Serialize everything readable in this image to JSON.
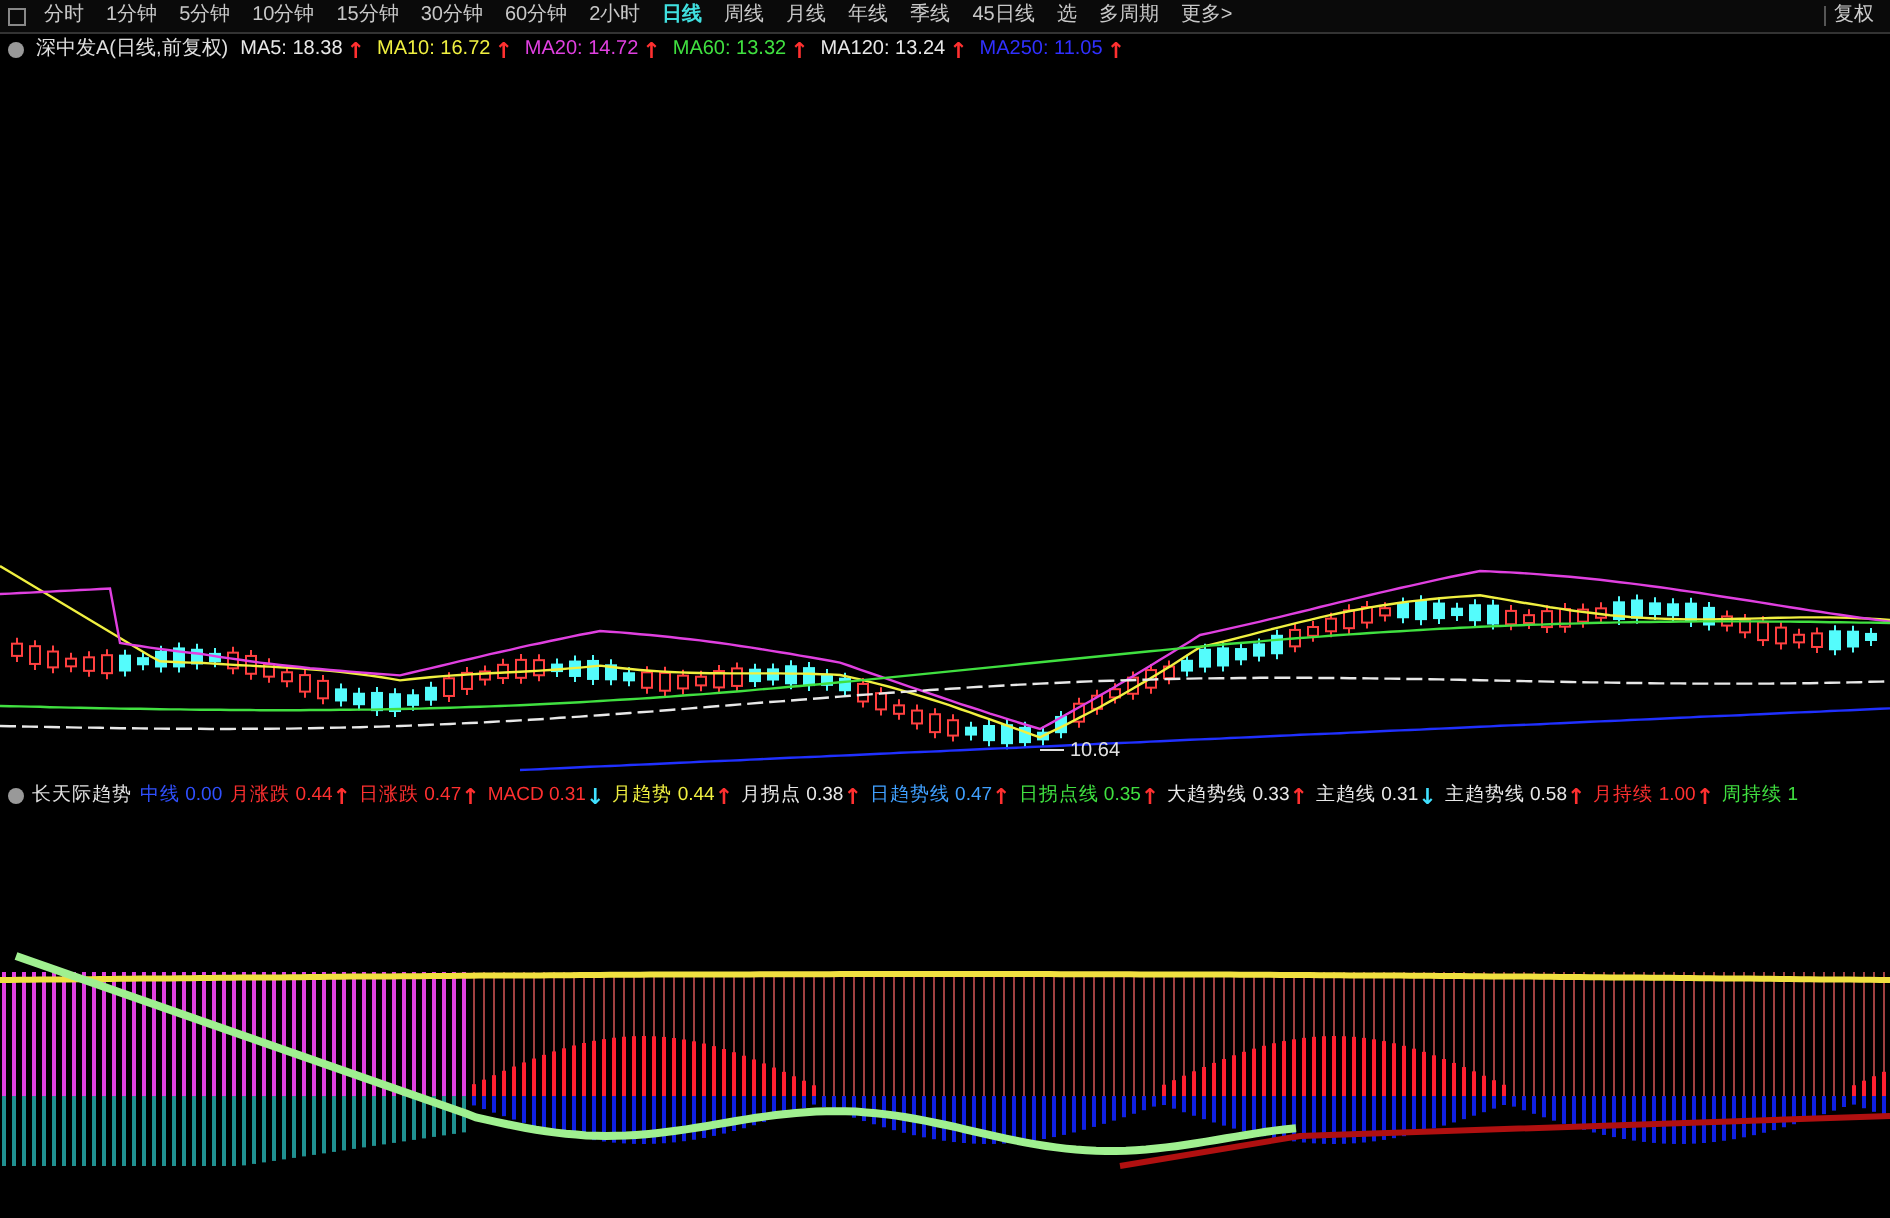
{
  "toolbar": {
    "tabs": [
      {
        "label": "分时",
        "selected": false
      },
      {
        "label": "1分钟",
        "selected": false
      },
      {
        "label": "5分钟",
        "selected": false
      },
      {
        "label": "10分钟",
        "selected": false
      },
      {
        "label": "15分钟",
        "selected": false
      },
      {
        "label": "30分钟",
        "selected": false
      },
      {
        "label": "60分钟",
        "selected": false
      },
      {
        "label": "2小时",
        "selected": false
      },
      {
        "label": "日线",
        "selected": true
      },
      {
        "label": "周线",
        "selected": false
      },
      {
        "label": "月线",
        "selected": false
      },
      {
        "label": "年线",
        "selected": false
      },
      {
        "label": "季线",
        "selected": false
      },
      {
        "label": "45日线",
        "selected": false
      },
      {
        "label": "选",
        "selected": false
      },
      {
        "label": "多周期",
        "selected": false
      },
      {
        "label": "更多>",
        "selected": false
      }
    ],
    "adjust_button": "复权"
  },
  "main_chart": {
    "title": "深中发A(日线,前复权)",
    "indicators": [
      {
        "name": "MA5:",
        "value": "18.38",
        "arrow": {
          "text": "↑",
          "color": "#ff3030"
        },
        "color": "#e8e8e8"
      },
      {
        "name": "MA10:",
        "value": "16.72",
        "arrow": {
          "text": "↑",
          "color": "#ff3030"
        },
        "color": "#f0f040"
      },
      {
        "name": "MA20:",
        "value": "14.72",
        "arrow": {
          "text": "↑",
          "color": "#ff3030"
        },
        "color": "#e040e0"
      },
      {
        "name": "MA60:",
        "value": "13.32",
        "arrow": {
          "text": "↑",
          "color": "#ff3030"
        },
        "color": "#40e040"
      },
      {
        "name": "MA120:",
        "value": "13.24",
        "arrow": {
          "text": "↑",
          "color": "#ff3030"
        },
        "color": "#e8e8e8"
      },
      {
        "name": "MA250:",
        "value": "11.05",
        "arrow": {
          "text": "↑",
          "color": "#ff3030"
        },
        "color": "#3030ff"
      }
    ],
    "low_label": "10.64"
  },
  "sub_chart": {
    "title": "长天际趋势",
    "indicators": [
      {
        "name": "中线",
        "value": "0.00",
        "color": "#3050ff"
      },
      {
        "name": "月涨跌",
        "value": "0.44",
        "arrow": {
          "text": "↑",
          "color": "#ff3030"
        },
        "color": "#ff3030"
      },
      {
        "name": "日涨跌",
        "value": "0.47",
        "arrow": {
          "text": "↑",
          "color": "#ff3030"
        },
        "color": "#ff3030"
      },
      {
        "name": "MACD",
        "value": "0.31",
        "arrow": {
          "text": "↓",
          "color": "#40e0ff"
        },
        "color": "#ff3030"
      },
      {
        "name": "月趋势",
        "value": "0.44",
        "arrow": {
          "text": "↑",
          "color": "#ff3030"
        },
        "color": "#f0f040"
      },
      {
        "name": "月拐点",
        "value": "0.38",
        "arrow": {
          "text": "↑",
          "color": "#ff3030"
        },
        "color": "#e8e8e8"
      },
      {
        "name": "日趋势线",
        "value": "0.47",
        "arrow": {
          "text": "↑",
          "color": "#ff3030"
        },
        "color": "#40a0ff"
      },
      {
        "name": "日拐点线",
        "value": "0.35",
        "arrow": {
          "text": "↑",
          "color": "#ff3030"
        },
        "color": "#40e040"
      },
      {
        "name": "大趋势线",
        "value": "0.33",
        "arrow": {
          "text": "↑",
          "color": "#ff3030"
        },
        "color": "#e8e8e8"
      },
      {
        "name": "主趋线",
        "value": "0.31",
        "arrow": {
          "text": "↓",
          "color": "#40e0ff"
        },
        "color": "#e8e8e8"
      },
      {
        "name": "主趋势线",
        "value": "0.58",
        "arrow": {
          "text": "↑",
          "color": "#ff3030"
        },
        "color": "#e8e8e8"
      },
      {
        "name": "月持续",
        "value": "1.00",
        "arrow": {
          "text": "↑",
          "color": "#ff3030"
        },
        "color": "#ff3030"
      },
      {
        "name": "周持续",
        "value": "1",
        "color": "#40e040"
      }
    ]
  }
}
